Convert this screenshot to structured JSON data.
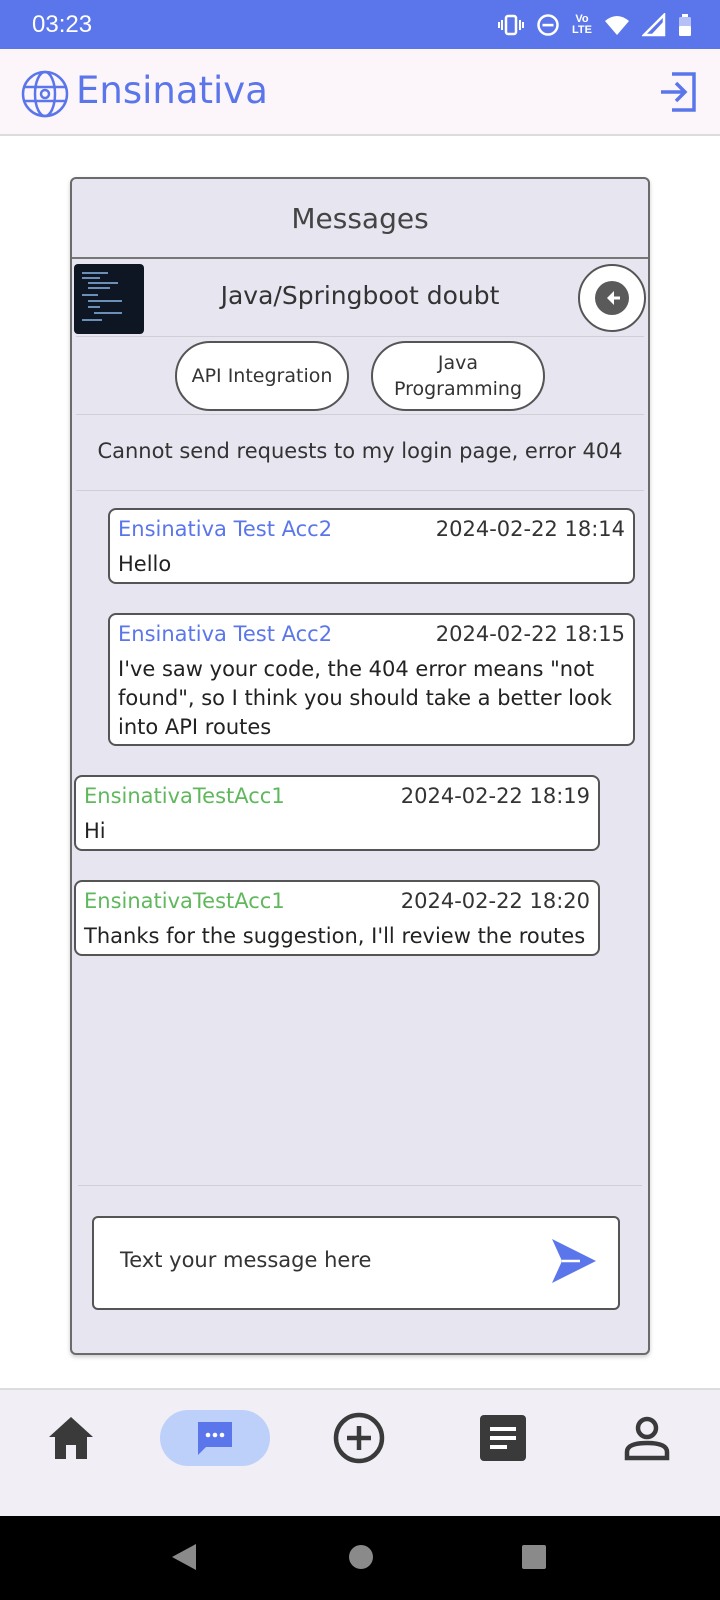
{
  "status_bar": {
    "time": "03:23",
    "volte_line1": "Vo",
    "volte_line2": "LTE",
    "icons": [
      "vibrate-icon",
      "dnd-icon",
      "volte-icon",
      "wifi-icon",
      "signal-icon",
      "battery-icon"
    ]
  },
  "app_bar": {
    "brand": "Ensinativa",
    "logo_icon": "globe-icon",
    "logout_icon": "logout-icon"
  },
  "panel": {
    "title": "Messages"
  },
  "thread": {
    "title": "Java/Springboot doubt",
    "tags": [
      "API Integration",
      "Java Programming"
    ],
    "question": "Cannot send requests to my login page, error 404"
  },
  "messages": [
    {
      "author": "Ensinativa Test Acc2",
      "date": "2024-02-22 18:14",
      "body": "Hello",
      "from_me": false
    },
    {
      "author": "Ensinativa Test Acc2",
      "date": "2024-02-22 18:15",
      "body": "I've saw your code, the 404 error means \"not found\", so I think you should take a better look into API routes",
      "from_me": false
    },
    {
      "author": "EnsinativaTestAcc1",
      "date": "2024-02-22 18:19",
      "body": "Hi",
      "from_me": true
    },
    {
      "author": "EnsinativaTestAcc1",
      "date": "2024-02-22 18:20",
      "body": "Thanks for the suggestion, I'll review the routes",
      "from_me": true
    }
  ],
  "composer": {
    "placeholder": "Text your message here"
  },
  "bottom_nav": {
    "items": [
      "home-icon",
      "messages-icon",
      "add-icon",
      "posts-icon",
      "profile-icon"
    ],
    "active": "messages-icon"
  },
  "colors": {
    "accent": "#5b76ea",
    "self_author": "#5fb85c",
    "panel_bg": "#e6e5f0"
  }
}
